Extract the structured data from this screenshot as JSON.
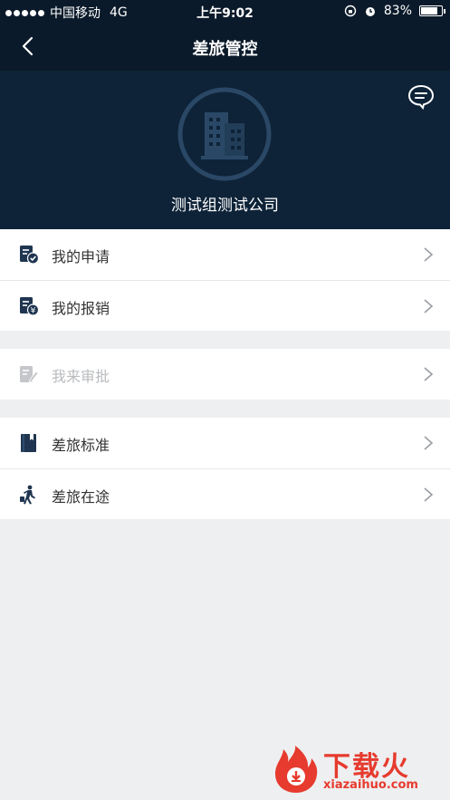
{
  "status_bar": {
    "carrier": "中国移动",
    "network": "4G",
    "time": "上午9:02",
    "battery_percent": "83%",
    "battery_level": 0.83
  },
  "nav": {
    "title": "差旅管控",
    "back_icon": "chevron-left-icon"
  },
  "header": {
    "company_name": "测试组测试公司",
    "logo_icon": "building-icon",
    "message_icon": "chat-bubble-icon"
  },
  "menu": {
    "group1": [
      {
        "label": "我的申请",
        "icon": "application-icon",
        "enabled": true
      },
      {
        "label": "我的报销",
        "icon": "reimbursement-icon",
        "enabled": true
      }
    ],
    "group2": [
      {
        "label": "我来审批",
        "icon": "approval-icon",
        "enabled": false
      }
    ],
    "group3": [
      {
        "label": "差旅标准",
        "icon": "book-icon",
        "enabled": true
      },
      {
        "label": "差旅在途",
        "icon": "traveler-icon",
        "enabled": true
      }
    ]
  },
  "watermark": {
    "title": "下载火",
    "url": "xiazaihuo.com"
  },
  "colors": {
    "nav_bg": "#0b1a2a",
    "hero_bg": "#0e2338",
    "icon_dark": "#1f3550",
    "icon_disabled": "#c5c7ca",
    "watermark": "#e63b2e"
  }
}
